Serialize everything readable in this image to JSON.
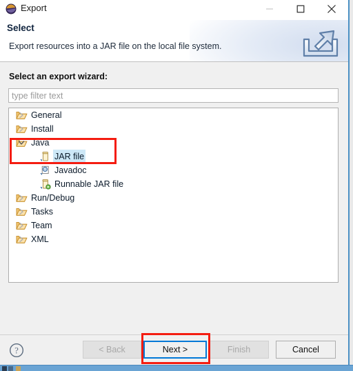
{
  "window": {
    "title": "Export",
    "app_icon": "eclipse-icon",
    "controls": {
      "minimize": "minimize-icon",
      "maximize": "maximize-icon",
      "close": "close-icon"
    }
  },
  "header": {
    "title": "Select",
    "description": "Export resources into a JAR file on the local file system.",
    "banner_icon": "export-arrow-icon"
  },
  "main": {
    "wizard_label": "Select an export wizard:",
    "filter": {
      "value": "",
      "placeholder": "type filter text"
    },
    "tree": [
      {
        "label": "General",
        "level": 0,
        "icon": "folder-icon",
        "expanded": false,
        "selected": false,
        "has_twisty": true
      },
      {
        "label": "Install",
        "level": 0,
        "icon": "folder-icon",
        "expanded": false,
        "selected": false,
        "has_twisty": true
      },
      {
        "label": "Java",
        "level": 0,
        "icon": "folder-icon",
        "expanded": true,
        "selected": false,
        "has_twisty": true
      },
      {
        "label": "JAR file",
        "level": 1,
        "icon": "jar-file-icon",
        "expanded": false,
        "selected": true,
        "has_twisty": false
      },
      {
        "label": "Javadoc",
        "level": 1,
        "icon": "javadoc-icon",
        "expanded": false,
        "selected": false,
        "has_twisty": false
      },
      {
        "label": "Runnable JAR file",
        "level": 1,
        "icon": "runnable-jar-icon",
        "expanded": false,
        "selected": false,
        "has_twisty": false
      },
      {
        "label": "Run/Debug",
        "level": 0,
        "icon": "folder-icon",
        "expanded": false,
        "selected": false,
        "has_twisty": true
      },
      {
        "label": "Tasks",
        "level": 0,
        "icon": "folder-icon",
        "expanded": false,
        "selected": false,
        "has_twisty": true
      },
      {
        "label": "Team",
        "level": 0,
        "icon": "folder-icon",
        "expanded": false,
        "selected": false,
        "has_twisty": true
      },
      {
        "label": "XML",
        "level": 0,
        "icon": "folder-icon",
        "expanded": false,
        "selected": false,
        "has_twisty": true
      }
    ]
  },
  "footer": {
    "help_icon": "help-question-icon",
    "buttons": {
      "back": {
        "label": "< Back",
        "enabled": false
      },
      "next": {
        "label": "Next >",
        "enabled": true,
        "focused": true
      },
      "finish": {
        "label": "Finish",
        "enabled": false
      },
      "cancel": {
        "label": "Cancel",
        "enabled": true
      }
    }
  },
  "annotations": [
    {
      "name": "jar-file-highlight",
      "color": "#f41c10"
    },
    {
      "name": "next-button-highlight",
      "color": "#f41c10"
    }
  ],
  "colors": {
    "accent_blue": "#0078d7",
    "annotation_red": "#f41c10",
    "selection_blue": "#cde8f7",
    "folder_yellow": "#f0c070",
    "taskbar_blue": "#6aa4d4"
  }
}
